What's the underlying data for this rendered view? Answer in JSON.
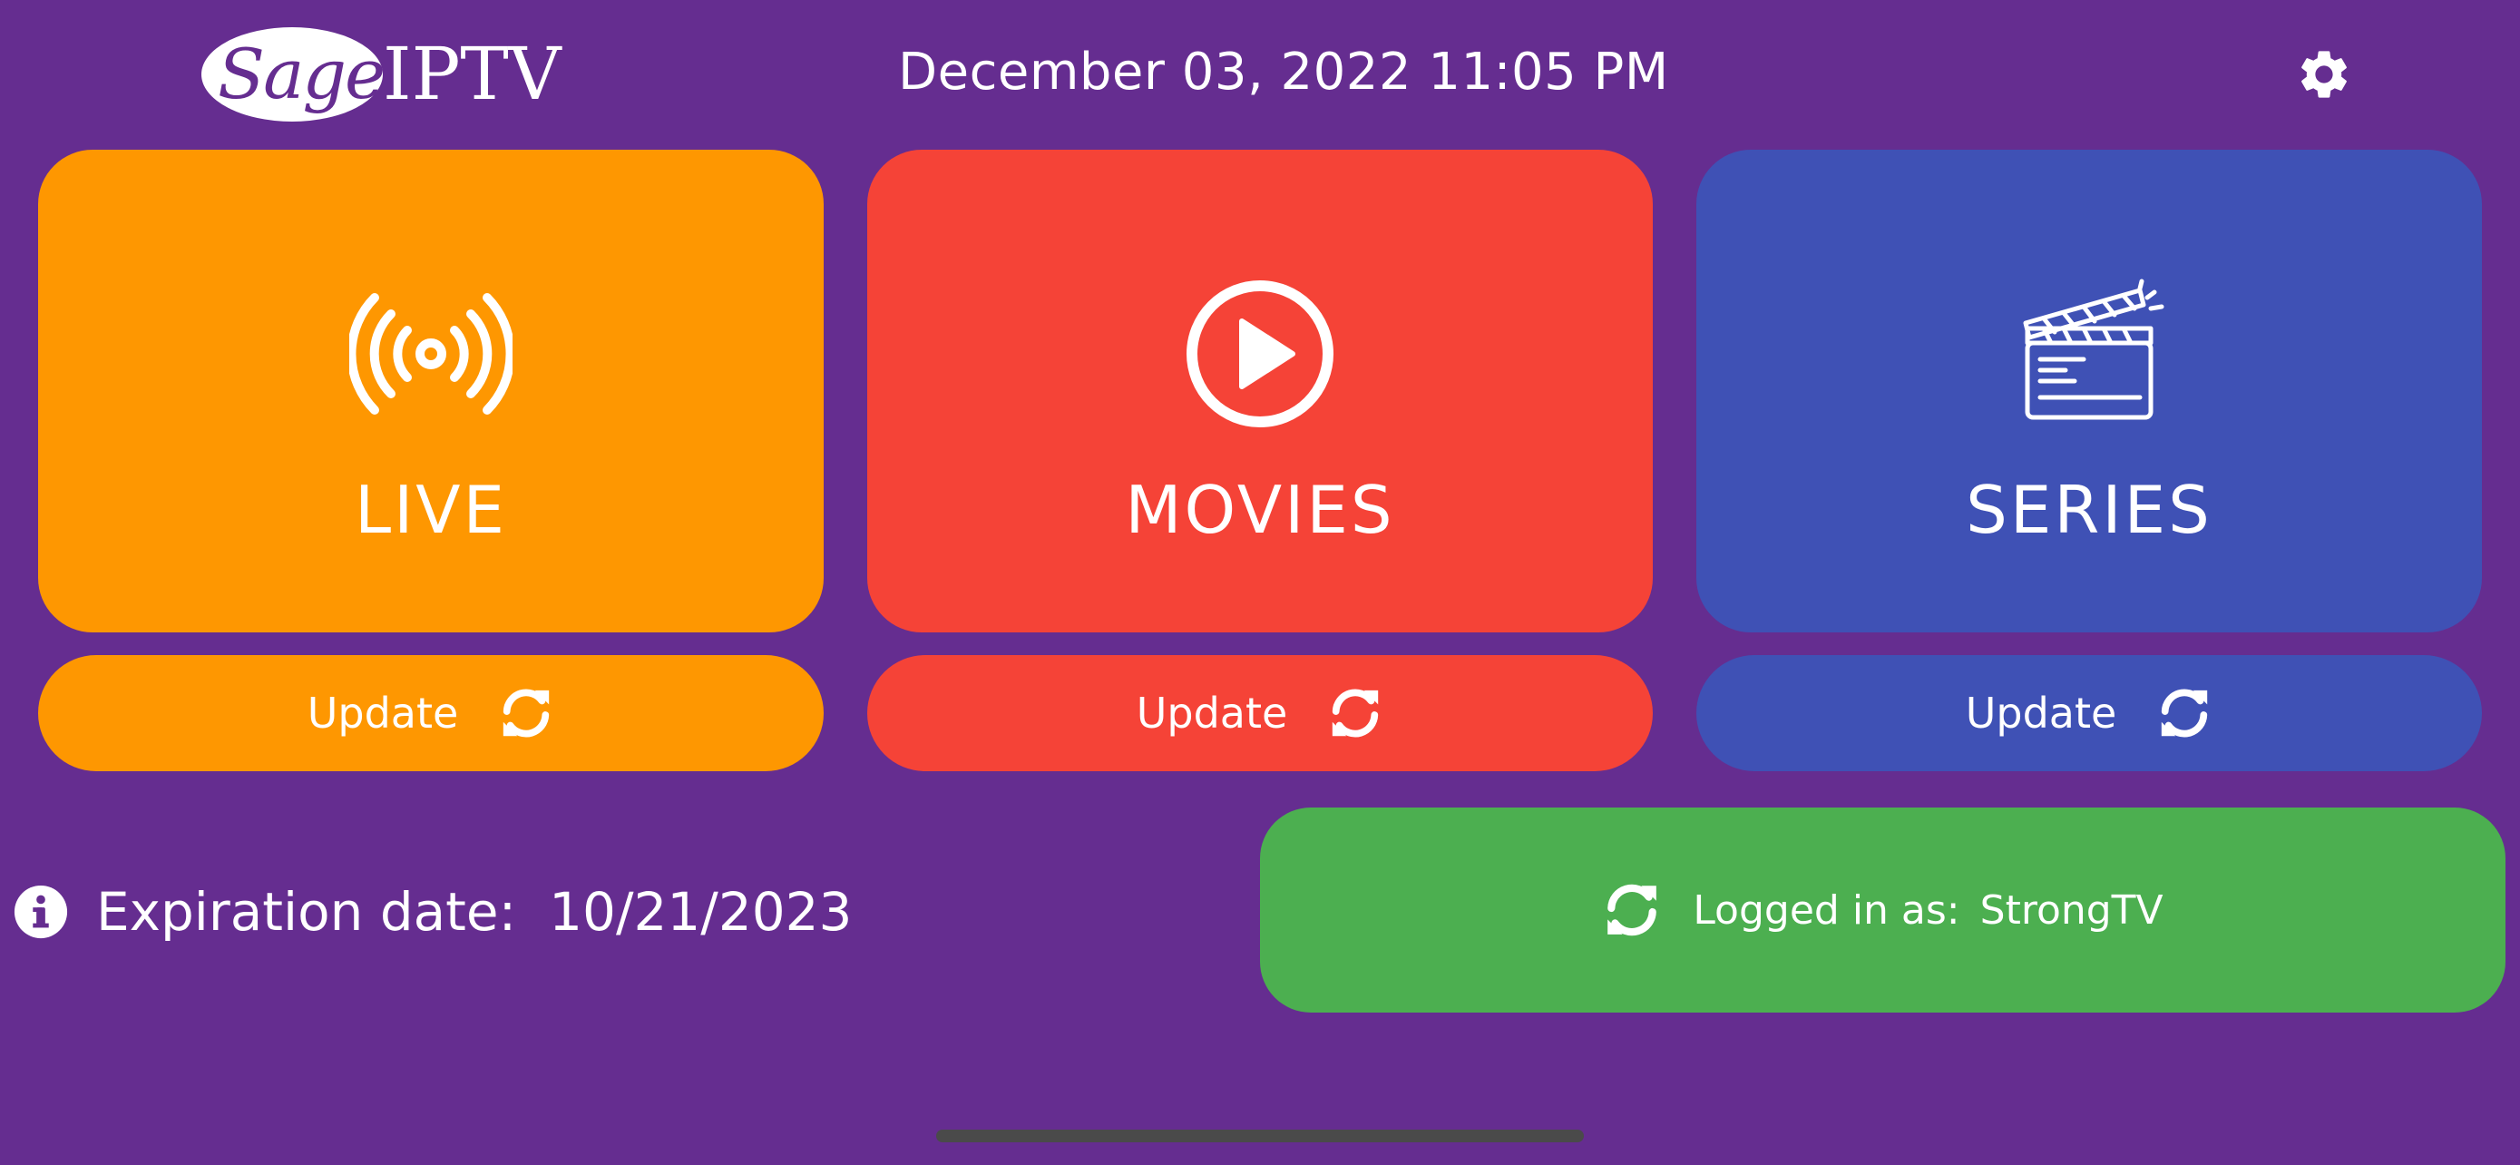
{
  "header": {
    "logo_sage": "Sage",
    "logo_iptv": "IPTV",
    "datetime": "December 03, 2022 11:05 PM",
    "settings_icon": "gear-icon"
  },
  "tiles": [
    {
      "label": "LIVE",
      "icon": "broadcast-icon",
      "update_label": "Update",
      "color": "#fe9701"
    },
    {
      "label": "MOVIES",
      "icon": "play-circle-icon",
      "update_label": "Update",
      "color": "#f54337"
    },
    {
      "label": "SERIES",
      "icon": "clapperboard-icon",
      "update_label": "Update",
      "color": "#3f51b5"
    }
  ],
  "footer": {
    "expiration_label": "Expiration date:",
    "expiration_value": "10/21/2023",
    "login_label": "Logged in as:",
    "login_user": "StrongTV",
    "login_color": "#4caf50"
  },
  "theme": {
    "background": "#652d90"
  }
}
